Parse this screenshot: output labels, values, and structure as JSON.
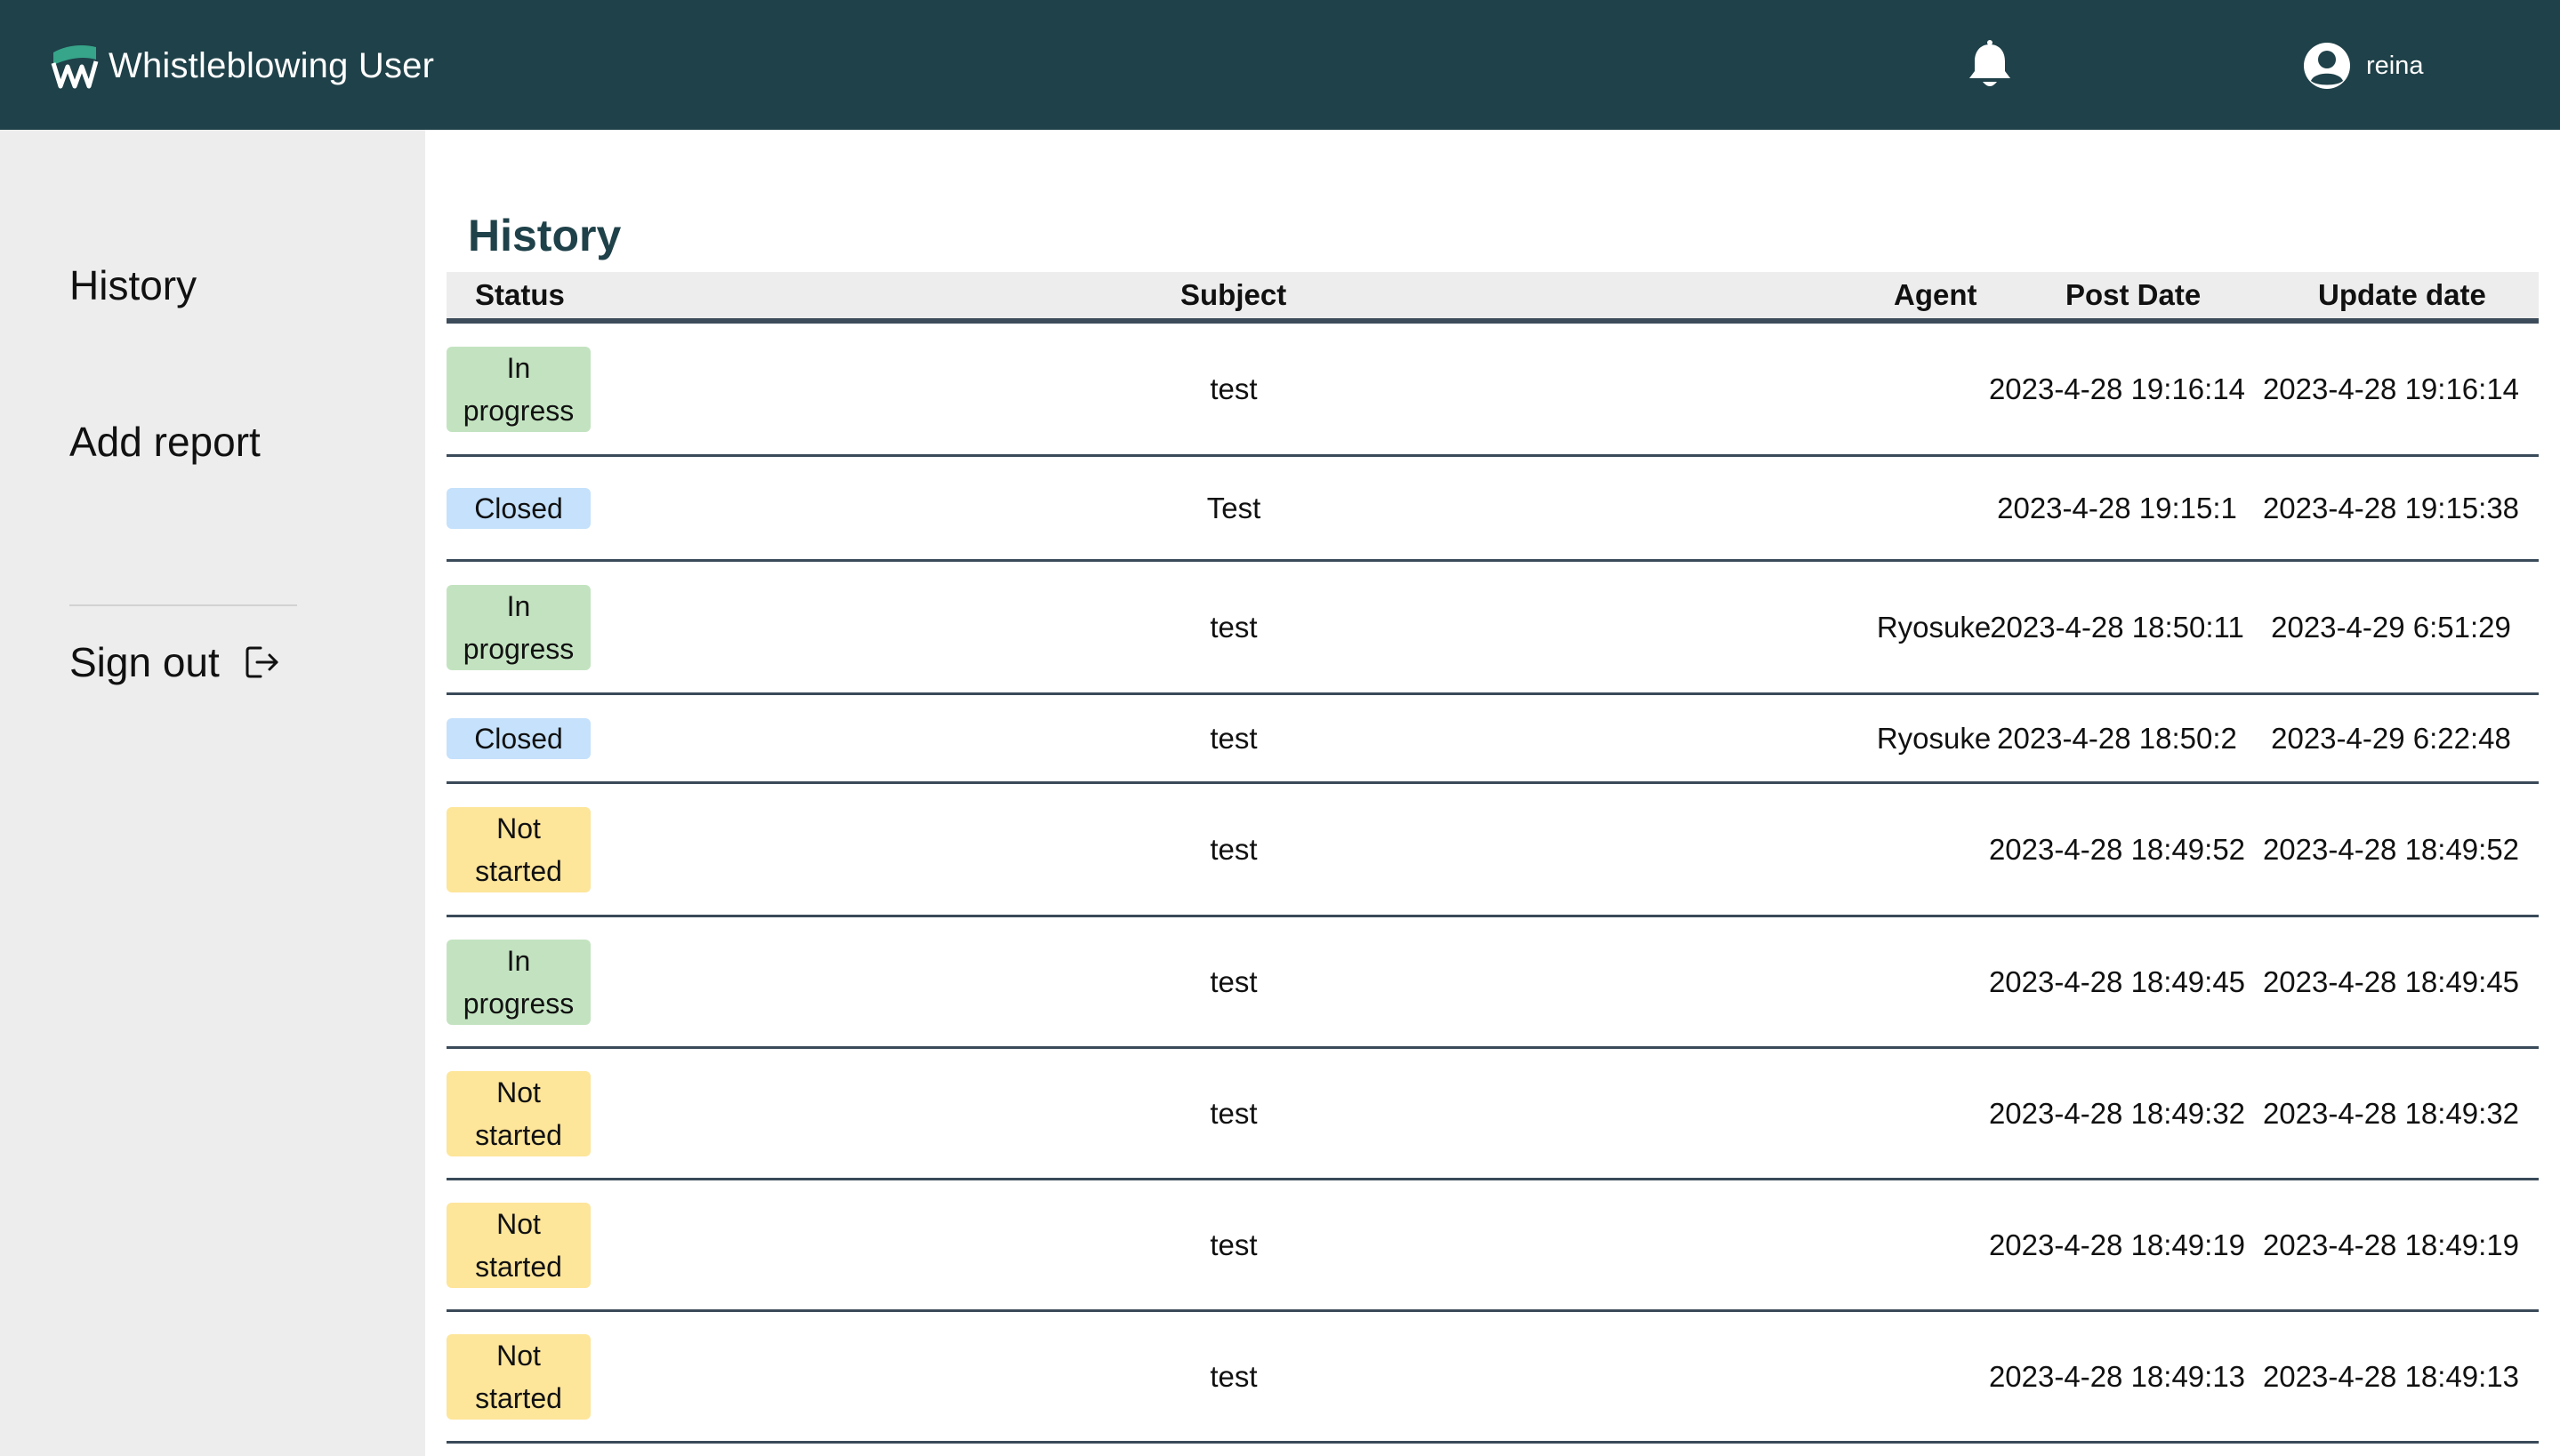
{
  "header": {
    "app_title": "Whistleblowing User",
    "logo_icon": "whistleblowing-logo",
    "notification_icon": "bell-icon",
    "user_icon": "user-circle-icon",
    "username": "reina",
    "background_color": "#1f4149"
  },
  "sidebar": {
    "items": [
      {
        "label": "History"
      },
      {
        "label": "Add report"
      }
    ],
    "sign_out": {
      "label": "Sign out",
      "icon": "sign-out-icon"
    }
  },
  "main": {
    "title": "History",
    "table": {
      "columns": {
        "status": "Status",
        "subject": "Subject",
        "agent": "Agent",
        "post_date": "Post Date",
        "update_date": "Update date"
      },
      "status_colors": {
        "In progress": "#c3e3c0",
        "Closed": "#c5e1fb",
        "Not started": "#fde59a"
      },
      "rows": [
        {
          "status": "In progress",
          "subject": "test",
          "agent": "",
          "post_date": "2023-4-28 19:16:14",
          "update_date": "2023-4-28 19:16:14"
        },
        {
          "status": "Closed",
          "subject": "Test",
          "agent": "",
          "post_date": "2023-4-28 19:15:1",
          "update_date": "2023-4-28 19:15:38"
        },
        {
          "status": "In progress",
          "subject": "test",
          "agent": "Ryosuke",
          "post_date": "2023-4-28 18:50:11",
          "update_date": "2023-4-29 6:51:29"
        },
        {
          "status": "Closed",
          "subject": "test",
          "agent": "Ryosuke",
          "post_date": "2023-4-28 18:50:2",
          "update_date": "2023-4-29 6:22:48"
        },
        {
          "status": "Not started",
          "subject": "test",
          "agent": "",
          "post_date": "2023-4-28 18:49:52",
          "update_date": "2023-4-28 18:49:52"
        },
        {
          "status": "In progress",
          "subject": "test",
          "agent": "",
          "post_date": "2023-4-28 18:49:45",
          "update_date": "2023-4-28 18:49:45"
        },
        {
          "status": "Not started",
          "subject": "test",
          "agent": "",
          "post_date": "2023-4-28 18:49:32",
          "update_date": "2023-4-28 18:49:32"
        },
        {
          "status": "Not started",
          "subject": "test",
          "agent": "",
          "post_date": "2023-4-28 18:49:19",
          "update_date": "2023-4-28 18:49:19"
        },
        {
          "status": "Not started",
          "subject": "test",
          "agent": "",
          "post_date": "2023-4-28 18:49:13",
          "update_date": "2023-4-28 18:49:13"
        }
      ]
    }
  }
}
